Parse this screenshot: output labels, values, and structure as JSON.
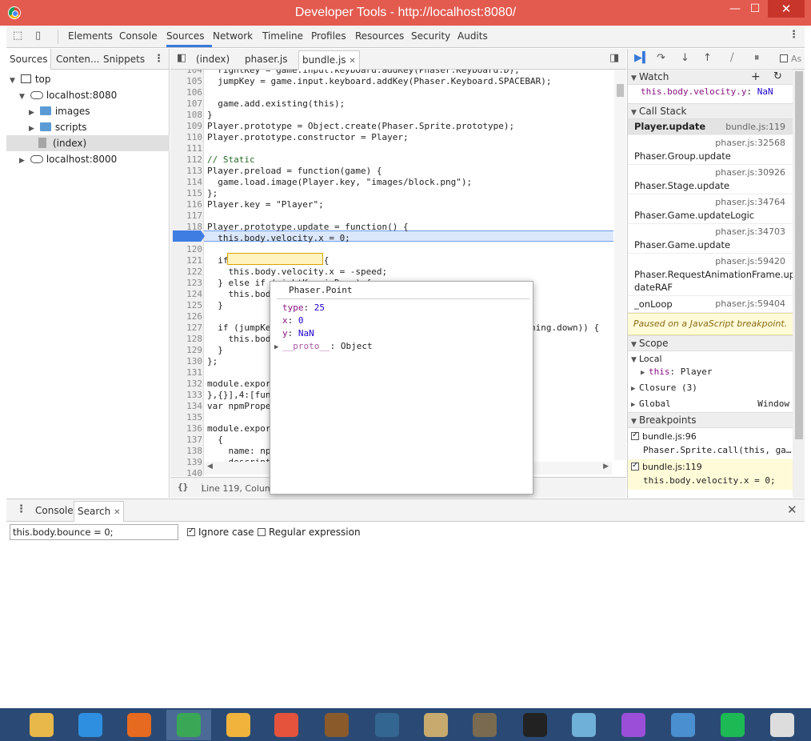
{
  "window": {
    "title": "Developer Tools - http://localhost:8080/"
  },
  "main_tabs": [
    "Elements",
    "Console",
    "Sources",
    "Network",
    "Timeline",
    "Profiles",
    "Resources",
    "Security",
    "Audits"
  ],
  "left_panel": {
    "tabs": [
      "Sources",
      "Conten...",
      "Snippets"
    ],
    "tree": [
      {
        "label": "top",
        "kind": "frame",
        "expanded": true
      },
      {
        "label": "localhost:8080",
        "kind": "cloud",
        "expanded": true
      },
      {
        "label": "images",
        "kind": "folder",
        "expanded": false
      },
      {
        "label": "scripts",
        "kind": "folder",
        "expanded": false
      },
      {
        "label": "(index)",
        "kind": "file",
        "selected": true
      },
      {
        "label": "localhost:8000",
        "kind": "cloud",
        "expanded": false
      }
    ]
  },
  "editor": {
    "tabs": [
      "(index)",
      "phaser.js",
      "bundle.js"
    ],
    "active_tab": "bundle.js",
    "current_line": 119,
    "lines": [
      {
        "n": "104",
        "t": "  rightKey = game.input.keyboard.addKey(Phaser.Keyboard.D);"
      },
      {
        "n": "105",
        "t": "  jumpKey = game.input.keyboard.addKey(Phaser.Keyboard.SPACEBAR);"
      },
      {
        "n": "106",
        "t": ""
      },
      {
        "n": "107",
        "t": "  game.add.existing(this);"
      },
      {
        "n": "108",
        "t": "}"
      },
      {
        "n": "109",
        "t": "Player.prototype = Object.create(Phaser.Sprite.prototype);"
      },
      {
        "n": "110",
        "t": "Player.prototype.constructor = Player;"
      },
      {
        "n": "111",
        "t": ""
      },
      {
        "n": "112",
        "t": "// Static"
      },
      {
        "n": "113",
        "t": "Player.preload = function(game) {"
      },
      {
        "n": "114",
        "t": "  game.load.image(Player.key, \"images/block.png\");"
      },
      {
        "n": "115",
        "t": "};"
      },
      {
        "n": "116",
        "t": "Player.key = \"Player\";"
      },
      {
        "n": "117",
        "t": ""
      },
      {
        "n": "118",
        "t": "Player.prototype.update = function() {"
      },
      {
        "n": "119",
        "t": "  this.body.velocity.x = 0;"
      },
      {
        "n": "120",
        "t": ""
      },
      {
        "n": "121",
        "t": "  if (leftKey.isDown) {"
      },
      {
        "n": "122",
        "t": "    this.body.velocity.x = -speed;"
      },
      {
        "n": "123",
        "t": "  } else if (rightKey.isDown) {"
      },
      {
        "n": "124",
        "t": "    this.bod"
      },
      {
        "n": "125",
        "t": "  }"
      },
      {
        "n": "126",
        "t": ""
      },
      {
        "n": "127",
        "t": "  if (jumpKe                                                thing.down)) {"
      },
      {
        "n": "128",
        "t": "    this.bod"
      },
      {
        "n": "129",
        "t": "  }"
      },
      {
        "n": "130",
        "t": "};"
      },
      {
        "n": "131",
        "t": ""
      },
      {
        "n": "132",
        "t": "module.expor"
      },
      {
        "n": "133",
        "t": "},{}],4:[fun"
      },
      {
        "n": "134",
        "t": "var npmPrope"
      },
      {
        "n": "135",
        "t": ""
      },
      {
        "n": "136",
        "t": "module.expor"
      },
      {
        "n": "137",
        "t": "  {"
      },
      {
        "n": "138",
        "t": "    name: np"
      },
      {
        "n": "139",
        "t": "    descript"
      },
      {
        "n": "140",
        "t": ""
      }
    ],
    "status": "Line 119, Colum"
  },
  "popover": {
    "title": "Phaser.Point",
    "props": [
      {
        "key": "type",
        "sep": ": ",
        "val": "25"
      },
      {
        "key": "x",
        "sep": ": ",
        "val": "0"
      },
      {
        "key": "y",
        "sep": ": ",
        "val": "NaN"
      },
      {
        "key": "__proto__",
        "sep": ": ",
        "val": "Object"
      }
    ]
  },
  "debugger": {
    "watch": {
      "label": "Watch",
      "expr": "this.body.velocity.y",
      "value": "NaN"
    },
    "call_stack": {
      "label": "Call Stack",
      "frames": [
        {
          "fn": "Player.update",
          "loc": "bundle.js:119"
        },
        {
          "fn": "Phaser.Group.update",
          "loc": "phaser.js:32568"
        },
        {
          "fn": "Phaser.Stage.update",
          "loc": "phaser.js:30926"
        },
        {
          "fn": "Phaser.Game.updateLogic",
          "loc": "phaser.js:34764"
        },
        {
          "fn": "Phaser.Game.update",
          "loc": "phaser.js:34703"
        },
        {
          "fn": "Phaser.RequestAnimationFrame.up",
          "fn2": "dateRAF",
          "loc": "phaser.js:59420"
        },
        {
          "fn": "_onLoop",
          "loc": "phaser.js:59404"
        }
      ]
    },
    "paused_msg": "Paused on a JavaScript breakpoint.",
    "scope": {
      "label": "Scope",
      "local": "Local",
      "this_key": "this",
      "this_val": "Player",
      "closure": "Closure (3)",
      "global": "Global",
      "global_val": "Window"
    },
    "breakpoints": {
      "label": "Breakpoints",
      "items": [
        {
          "file": "bundle.js:96",
          "code": "Phaser.Sprite.call(this, ga…"
        },
        {
          "file": "bundle.js:119",
          "code": "this.body.velocity.x = 0;"
        }
      ]
    },
    "async_label": "As"
  },
  "drawer": {
    "tabs": [
      "Console",
      "Search"
    ],
    "search_value": "this.body.bounce = 0;",
    "ignore_case": "Ignore case",
    "regex": "Regular expression"
  },
  "taskbar": {
    "apps": [
      {
        "name": "file-explorer-icon",
        "color": "#e8b84a"
      },
      {
        "name": "internet-explorer-icon",
        "color": "#2e8fe0"
      },
      {
        "name": "firefox-icon",
        "color": "#e66a1f"
      },
      {
        "name": "chrome-icon",
        "color": "#3aa757",
        "active": true
      },
      {
        "name": "chrome-canary-icon",
        "color": "#f2b33d"
      },
      {
        "name": "git-icon",
        "color": "#e5533c"
      },
      {
        "name": "hearthstone-icon",
        "color": "#8b5a2b"
      },
      {
        "name": "postgresql-icon",
        "color": "#336791"
      },
      {
        "name": "league-of-legends-icon",
        "color": "#c8aa6e"
      },
      {
        "name": "gimp-icon",
        "color": "#7a6a4f"
      },
      {
        "name": "inkscape-icon",
        "color": "#222222"
      },
      {
        "name": "starcraft-icon",
        "color": "#6fb0d8"
      },
      {
        "name": "gale-icon",
        "color": "#9b4fd8"
      },
      {
        "name": "diablo-icon",
        "color": "#4a8fd0"
      },
      {
        "name": "spotify-icon",
        "color": "#1db954"
      },
      {
        "name": "unity-icon",
        "color": "#dddddd"
      }
    ]
  }
}
